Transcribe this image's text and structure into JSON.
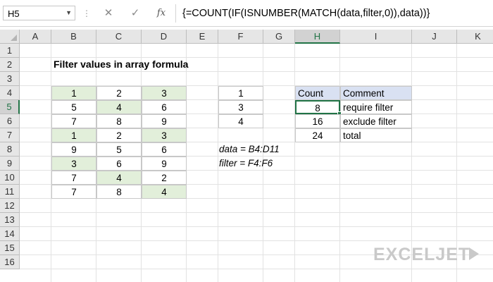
{
  "formula_bar": {
    "name_box": "H5",
    "cancel_icon": "✕",
    "enter_icon": "✓",
    "fx_label": "fx",
    "formula": "{=COUNT(IF(ISNUMBER(MATCH(data,filter,0)),data))}"
  },
  "columns": [
    "A",
    "B",
    "C",
    "D",
    "E",
    "F",
    "G",
    "H",
    "I",
    "J",
    "K"
  ],
  "rows": [
    "1",
    "2",
    "3",
    "4",
    "5",
    "6",
    "7",
    "8",
    "9",
    "10",
    "11",
    "12",
    "13",
    "14",
    "15",
    "16"
  ],
  "selected_cell": "H5",
  "title": "Filter values in array formula",
  "data_table": [
    [
      "1",
      "2",
      "3"
    ],
    [
      "5",
      "4",
      "6"
    ],
    [
      "7",
      "8",
      "9"
    ],
    [
      "1",
      "2",
      "3"
    ],
    [
      "9",
      "5",
      "6"
    ],
    [
      "3",
      "6",
      "9"
    ],
    [
      "7",
      "4",
      "2"
    ],
    [
      "7",
      "8",
      "4"
    ]
  ],
  "filter_values": [
    "1",
    "3",
    "4"
  ],
  "notes": {
    "data": "data = B4:D11",
    "filter": "filter = F4:F6"
  },
  "summary": {
    "headers": [
      "Count",
      "Comment"
    ],
    "rows": [
      {
        "count": "8",
        "comment": "require filter"
      },
      {
        "count": "16",
        "comment": "exclude filter"
      },
      {
        "count": "24",
        "comment": "total"
      }
    ]
  },
  "colors": {
    "highlight_green": "#e2efda",
    "header_blue": "#d9e1f2",
    "selection_green": "#217346"
  },
  "logo": "EXCELJET"
}
